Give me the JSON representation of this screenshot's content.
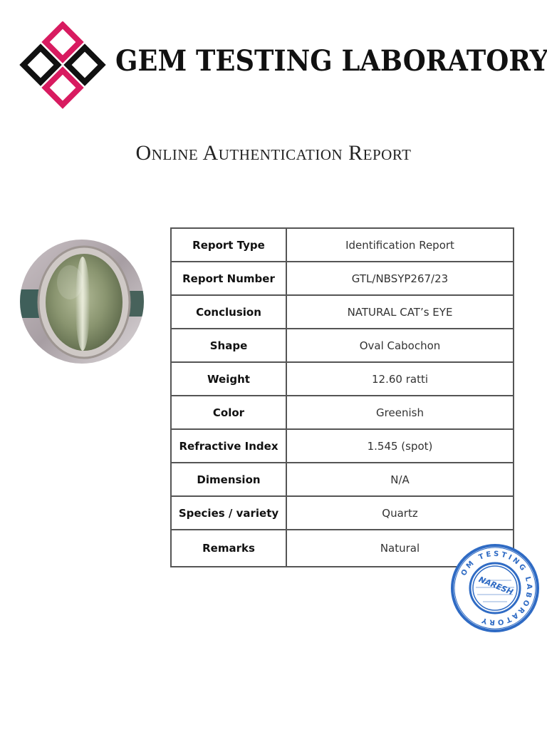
{
  "header": {
    "lab_name": "GEM TESTING LABORATORY",
    "logo_icon": "diamond-grid-logo-icon",
    "brand_colors": {
      "pink": "#d81b60",
      "black": "#111111"
    }
  },
  "title": "Online Authentication Report",
  "gem_image": {
    "icon": "cats-eye-ring-photo",
    "description_colors": {
      "stone": "#8a9570",
      "metal": "#b9b2ae"
    }
  },
  "report_rows": [
    {
      "label": "Report Type",
      "value": "Identification Report"
    },
    {
      "label": "Report Number",
      "value": "GTL/NBSYP267/23"
    },
    {
      "label": "Conclusion",
      "value": "NATURAL CAT’s EYE"
    },
    {
      "label": "Shape",
      "value": "Oval Cabochon"
    },
    {
      "label": "Weight",
      "value": "12.60 ratti"
    },
    {
      "label": "Color",
      "value": "Greenish"
    },
    {
      "label": "Refractive Index",
      "value": "1.545 (spot)"
    },
    {
      "label": "Dimension",
      "value": "N/A"
    },
    {
      "label": "Species / variety",
      "value": "Quartz"
    },
    {
      "label": "Remarks",
      "value": "Natural"
    }
  ],
  "stamp": {
    "ring_text": "OM TESTING LABORATORY",
    "center_text": "NARESH",
    "color": "#2f6bc4"
  }
}
